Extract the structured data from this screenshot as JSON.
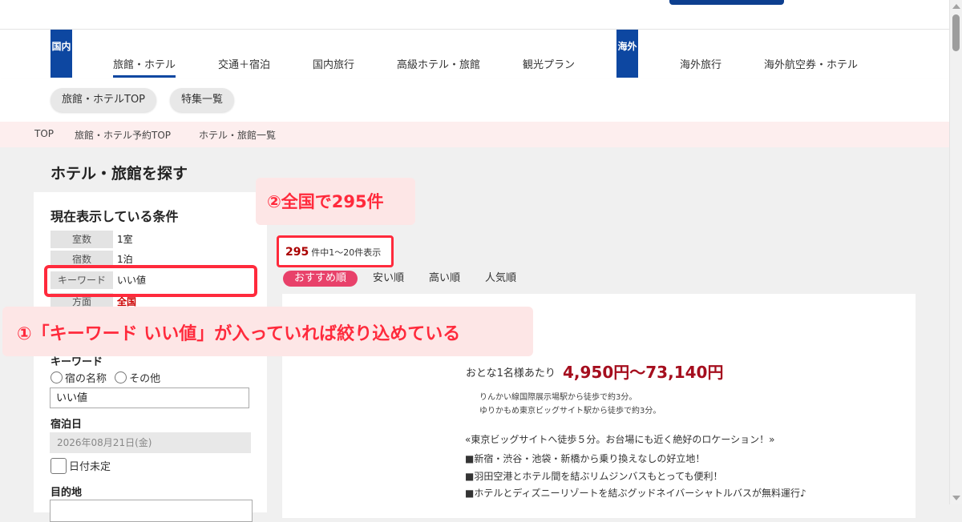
{
  "nav": {
    "region_domestic": "国内",
    "region_overseas": "海外",
    "items": [
      "旅館・ホテル",
      "交通＋宿泊",
      "国内旅行",
      "高級ホテル・旅館",
      "観光プラン",
      "海外旅行",
      "海外航空券・ホテル"
    ]
  },
  "subnav": {
    "pills": [
      "旅館・ホテルTOP",
      "特集一覧"
    ]
  },
  "breadcrumb": [
    "TOP",
    "旅館・ホテル予約TOP",
    "ホテル・旅館一覧"
  ],
  "page_title": "ホテル・旅館を探す",
  "conditions": {
    "title": "現在表示している条件",
    "rows": [
      {
        "label": "室数",
        "value": "1室"
      },
      {
        "label": "宿数",
        "value": "1泊"
      },
      {
        "label": "キーワード",
        "value": "いい値"
      },
      {
        "label": "方面",
        "value": "全国"
      }
    ]
  },
  "search_form": {
    "keyword_label": "キーワード",
    "radio_name": "宿の名称",
    "radio_other": "その他",
    "keyword_value": "いい値",
    "date_label": "宿泊日",
    "date_value": "2026年08月21日(金)",
    "undecided_label": "日付未定",
    "destination_label": "目的地"
  },
  "results": {
    "count": "295",
    "count_suffix": "件中1～20件表示",
    "sort_tabs": [
      "おすすめ順",
      "安い順",
      "高い順",
      "人気順"
    ]
  },
  "card": {
    "price_label": "おとな1名様あたり",
    "price": "4,950円～73,140円",
    "access": [
      "りんかい線国際展示場駅から徒歩で約3分。",
      "ゆりかもめ東京ビッグサイト駅から徒歩で約3分。"
    ],
    "description": [
      "«東京ビッグサイトへ徒歩５分。お台場にも近く絶好のロケーション！»",
      "■新宿・渋谷・池袋・新橋から乗り換えなしの好立地！",
      "■羽田空港とホテル間を結ぶリムジンバスもとっても便利！",
      "■ホテルとディズニーリゾートを結ぶグッドネイバーシャトルバスが無料運行♪"
    ]
  },
  "annotations": {
    "callout1": "①「キーワード いい値」が入っていれば絞り込めている",
    "callout2": "②全国で295件"
  },
  "colors": {
    "brand_blue": "#0d47a1",
    "annotation_red": "#ff2a3c",
    "price_red": "#a50e1e",
    "sort_active": "#e8416a"
  }
}
